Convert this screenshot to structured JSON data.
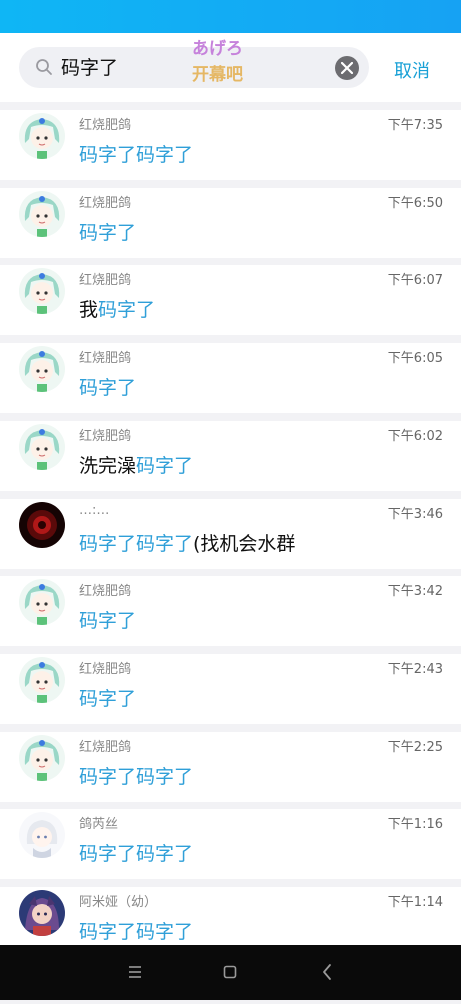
{
  "search": {
    "query": "码字了",
    "cancel_label": "取消"
  },
  "sticker": {
    "line1": "あげろ",
    "line2": "开幕吧"
  },
  "results": [
    {
      "name": "红烧肥鸽",
      "time": "下午7:35",
      "pre": "",
      "hl": "码字了码字了",
      "post": "",
      "avatar": "green-hair"
    },
    {
      "name": "红烧肥鸽",
      "time": "下午6:50",
      "pre": "",
      "hl": "码字了",
      "post": "",
      "avatar": "green-hair"
    },
    {
      "name": "红烧肥鸽",
      "time": "下午6:07",
      "pre": "我",
      "hl": "码字了",
      "post": "",
      "avatar": "green-hair"
    },
    {
      "name": "红烧肥鸽",
      "time": "下午6:05",
      "pre": "",
      "hl": "码字了",
      "post": "",
      "avatar": "green-hair"
    },
    {
      "name": "红烧肥鸽",
      "time": "下午6:02",
      "pre": "洗完澡",
      "hl": "码字了",
      "post": "",
      "avatar": "green-hair"
    },
    {
      "name": "…:…",
      "time": "下午3:46",
      "pre": "",
      "hl": "码字了码字了",
      "post": "(找机会水群",
      "avatar": "dark-red"
    },
    {
      "name": "红烧肥鸽",
      "time": "下午3:42",
      "pre": "",
      "hl": "码字了",
      "post": "",
      "avatar": "green-hair"
    },
    {
      "name": "红烧肥鸽",
      "time": "下午2:43",
      "pre": "",
      "hl": "码字了",
      "post": "",
      "avatar": "green-hair"
    },
    {
      "name": "红烧肥鸽",
      "time": "下午2:25",
      "pre": "",
      "hl": "码字了码字了",
      "post": "",
      "avatar": "green-hair"
    },
    {
      "name": "鸽芮丝",
      "time": "下午1:16",
      "pre": "",
      "hl": "码字了码字了",
      "post": "",
      "avatar": "white-hair"
    },
    {
      "name": "阿米娅（幼）",
      "time": "下午1:14",
      "pre": "",
      "hl": "码字了码字了",
      "post": "",
      "avatar": "purple"
    }
  ],
  "colors": {
    "highlight": "#2f9fd8",
    "accent": "#18a0d6",
    "status_bar": "#13aef5"
  },
  "nav": {
    "icons": [
      "menu-icon",
      "home-square-icon",
      "back-chevron-icon"
    ]
  }
}
